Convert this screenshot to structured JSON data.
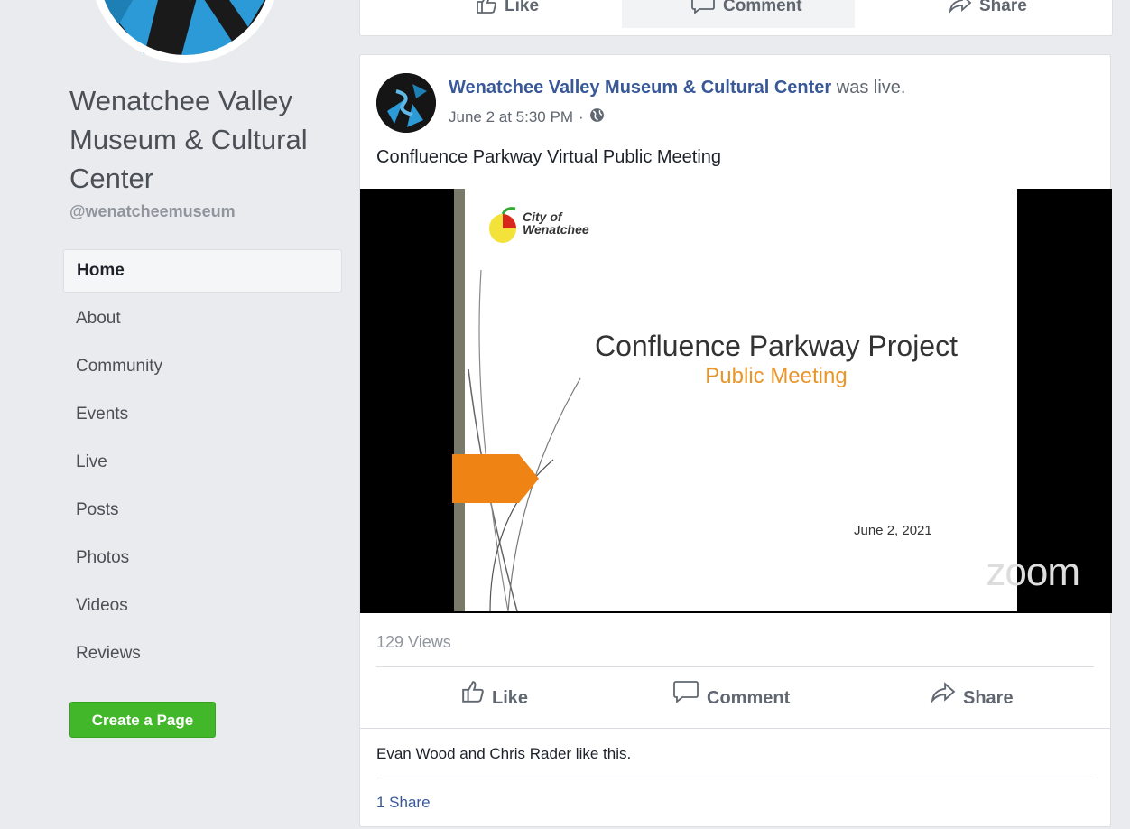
{
  "sidebar": {
    "page_name": "Wenatchee Valley Museum & Cultural Center",
    "handle": "@wenatcheemuseum",
    "nav": [
      {
        "label": "Home",
        "active": true
      },
      {
        "label": "About"
      },
      {
        "label": "Community"
      },
      {
        "label": "Events"
      },
      {
        "label": "Live"
      },
      {
        "label": "Posts"
      },
      {
        "label": "Photos"
      },
      {
        "label": "Videos"
      },
      {
        "label": "Reviews"
      }
    ],
    "create_page_label": "Create a Page"
  },
  "top_card": {
    "like_label": "Like",
    "comment_label": "Comment",
    "share_label": "Share"
  },
  "post": {
    "author": "Wenatchee Valley Museum & Cultural Center",
    "verb": "was live.",
    "timestamp": "June 2 at 5:30 PM",
    "separator": "·",
    "audience_icon": "globe-icon",
    "text": "Confluence Parkway Virtual Public Meeting",
    "video": {
      "logo_line1": "City of",
      "logo_line2": "Wenatchee",
      "title": "Confluence Parkway Project",
      "subtitle": "Public Meeting",
      "date": "June 2, 2021",
      "watermark": "zoom"
    },
    "views": "129 Views",
    "actions": {
      "like_label": "Like",
      "comment_label": "Comment",
      "share_label": "Share"
    },
    "likers": "Evan Wood and Chris Rader like this.",
    "shares": "1 Share"
  },
  "colors": {
    "link": "#385898",
    "create_button": "#42b72a",
    "slide_accent": "#e8962a",
    "background": "#e9ebee"
  }
}
